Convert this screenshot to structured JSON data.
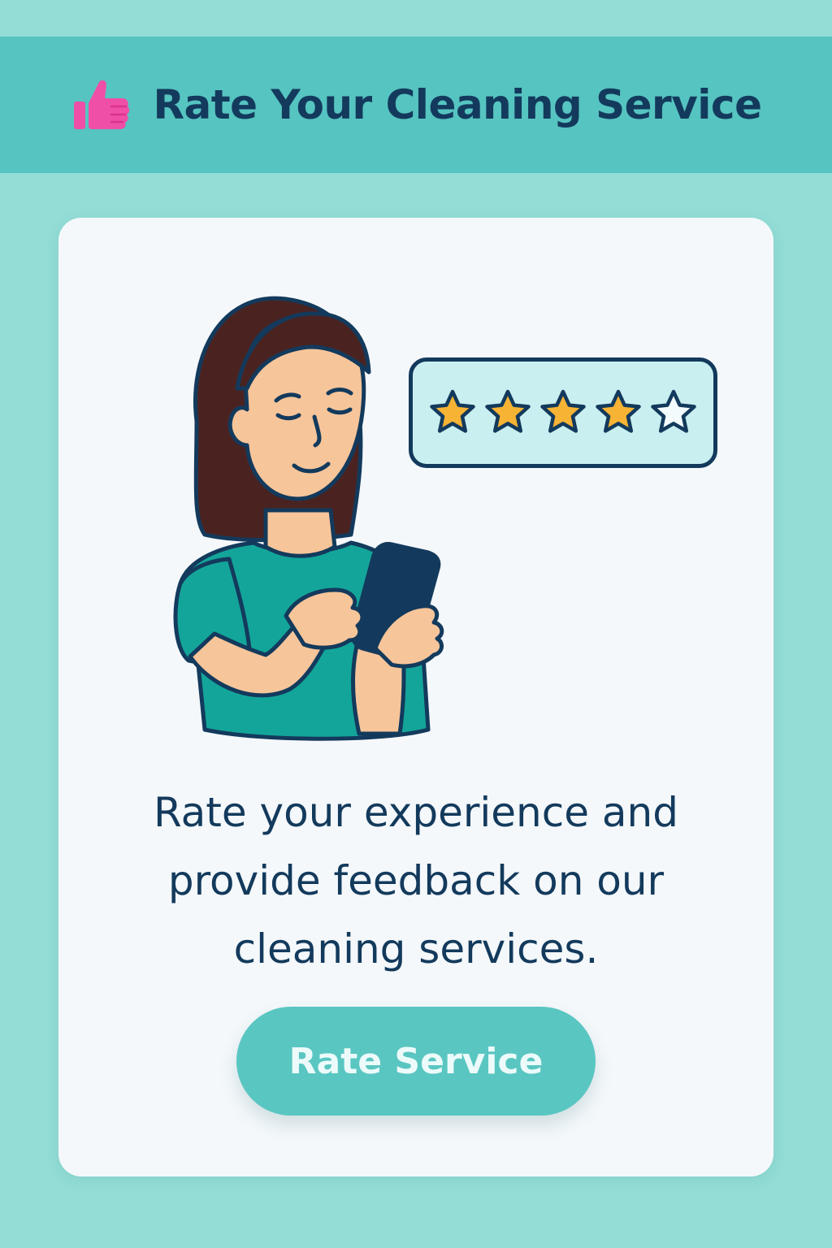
{
  "header": {
    "title": "Rate Your Cleaning Service",
    "icon": "thumbs-up-icon"
  },
  "card": {
    "rating": {
      "filled_stars": 4,
      "total_stars": 5
    },
    "description": "Rate your experience and provide feedback on our cleaning services.",
    "button_label": "Rate Service"
  },
  "colors": {
    "page_background": "#93ddd6",
    "header_background": "#56c4c1",
    "title_text": "#133a5c",
    "thumb_icon": "#ef4fa6",
    "star_filled": "#f6b334",
    "button_background": "#5ac6c2",
    "button_text": "#ecfbfa",
    "card_background": "#f4f8fb"
  }
}
